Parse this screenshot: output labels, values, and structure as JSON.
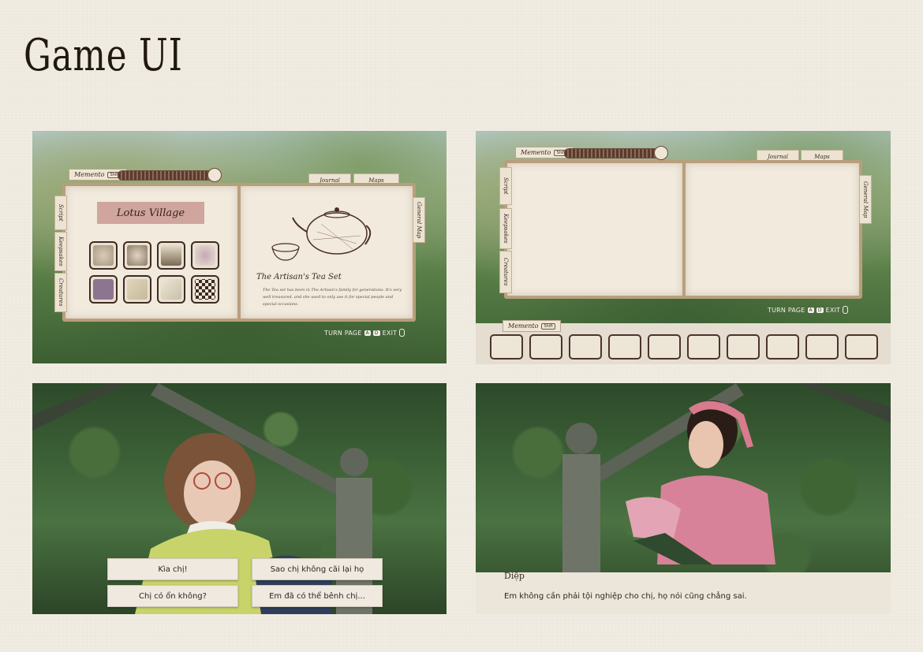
{
  "page": {
    "title": "Game UI"
  },
  "hud": {
    "mementos_label": "Memento",
    "shift_key": "Shift",
    "journal_tab": "Journal",
    "maps_tab": "Maps",
    "side_tabs_left": [
      "Script",
      "Keepsakes",
      "Creatures"
    ],
    "side_tab_right": "General Map",
    "turn_page_label": "TURN PAGE",
    "key_a": "A",
    "key_d": "D",
    "exit_label": "EXIT"
  },
  "collection": {
    "location_title": "Lotus Village",
    "item_title": "The Artisan's Tea Set",
    "item_description": "The Tea set has been in The Artisan's family for generations. It's very well treasured, and she used to only use it for special people and special occasions."
  },
  "inventory": {
    "label": "Memento",
    "slot_count": 10
  },
  "dialogue_choices": {
    "choices": [
      "Kìa chị!",
      "Sao chị không cãi lại họ",
      "Chị có ổn không?",
      "Em đã có thể bênh chị..."
    ]
  },
  "dialogue_line": {
    "speaker": "Diệp",
    "text": "Em không cần phải tội nghiệp cho chị, họ nói cũng chẳng sai."
  },
  "colors": {
    "paper": "#f1eadd",
    "ribbon": "#cfa59d",
    "ink": "#3a2a22",
    "background": "#f1ece2"
  }
}
